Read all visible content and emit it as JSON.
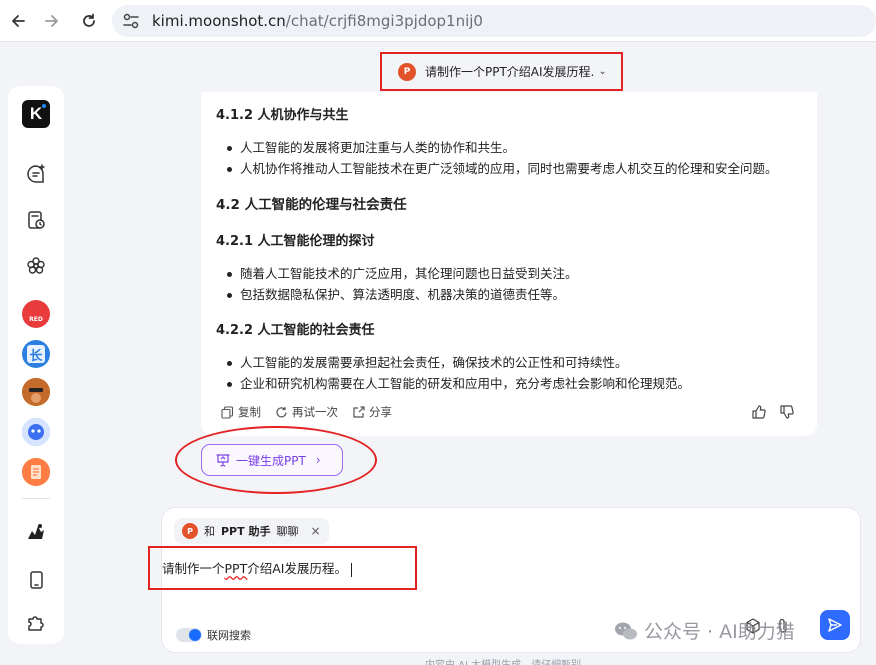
{
  "browser": {
    "url_host": "kimi.moonshot.cn",
    "url_path": "/chat/crjfi8mgi3pjdop1nij0"
  },
  "header": {
    "chat_title": "请制作一个PPT介绍AI发展历程.",
    "ppt_badge": "P"
  },
  "sidebar": {
    "logo": "K",
    "avatars": [
      "RED",
      "长"
    ]
  },
  "chat": {
    "sections": [
      {
        "heading": "4.1.2 人机协作与共生",
        "level": 4,
        "bullets": [
          "人工智能的发展将更加注重与人类的协作和共生。",
          "人机协作将推动人工智能技术在更广泛领域的应用，同时也需要考虑人机交互的伦理和安全问题。"
        ]
      },
      {
        "heading": "4.2 人工智能的伦理与社会责任",
        "level": 3,
        "bullets": []
      },
      {
        "heading": "4.2.1 人工智能伦理的探讨",
        "level": 4,
        "bullets": [
          "随着人工智能技术的广泛应用，其伦理问题也日益受到关注。",
          "包括数据隐私保护、算法透明度、机器决策的道德责任等。"
        ]
      },
      {
        "heading": "4.2.2 人工智能的社会责任",
        "level": 4,
        "bullets": [
          "人工智能的发展需要承担起社会责任，确保技术的公正性和可持续性。",
          "企业和研究机构需要在人工智能的研发和应用中，充分考虑社会影响和伦理规范。"
        ]
      }
    ],
    "actions": {
      "copy": "复制",
      "retry": "再试一次",
      "share": "分享"
    }
  },
  "generate_ppt": {
    "label": "一键生成PPT",
    "arrow": "›"
  },
  "input": {
    "assistant_prefix": "和",
    "assistant_name": "PPT 助手",
    "assistant_suffix": "聊聊",
    "close": "×",
    "text_before": "请制作一个",
    "text_squiggle": "PPT",
    "text_after": "介绍AI发展历程。",
    "web_search_label": "联网搜索"
  },
  "watermark": {
    "text": "公众号 · AI助力猎"
  },
  "footer": {
    "note": "内容由 AI 大模型生成，请仔细甄别"
  }
}
